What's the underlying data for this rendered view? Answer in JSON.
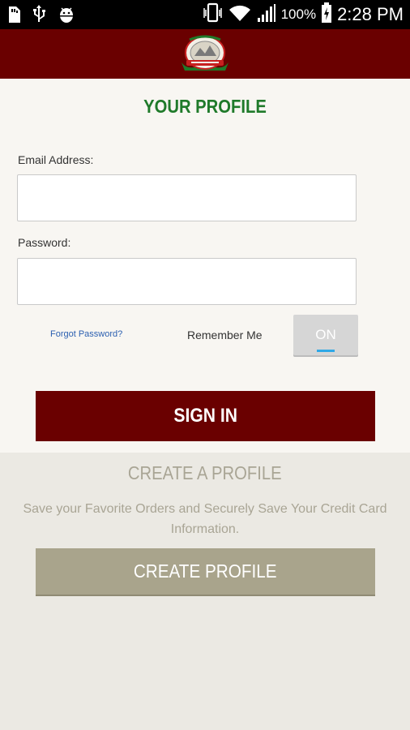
{
  "status_bar": {
    "battery_pct": "100%",
    "time": "2:28 PM",
    "icons": [
      "sd-card-icon",
      "usb-icon",
      "android-debug-icon",
      "phone-vibrate-icon",
      "wifi-icon",
      "signal-icon",
      "battery-charging-icon"
    ]
  },
  "header": {
    "logo_icon": "restaurant-logo-icon"
  },
  "profile": {
    "title": "YOUR PROFILE",
    "email_label": "Email Address:",
    "email_value": "",
    "password_label": "Password:",
    "password_value": "",
    "forgot_label": "Forgot Password?",
    "remember_label": "Remember Me",
    "toggle_label": "ON",
    "sign_in_label": "SIGN IN"
  },
  "create": {
    "title": "CREATE A PROFILE",
    "description": "Save your Favorite Orders and Securely Save Your Credit Card Information.",
    "button_label": "CREATE PROFILE"
  },
  "colors": {
    "header_bg": "#6a0000",
    "title_green": "#1f7a2a",
    "create_btn": "#a9a48c",
    "toggle_indicator": "#2fa8e6"
  }
}
